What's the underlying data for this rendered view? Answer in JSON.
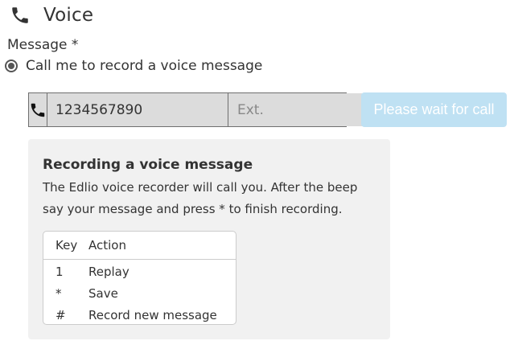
{
  "header": {
    "icon": "phone-icon",
    "title": "Voice"
  },
  "message_field": {
    "label": "Message *",
    "option_label": "Call me to record a voice message",
    "option_selected": true
  },
  "phone_form": {
    "icon": "phone-icon",
    "phone_value": "1234567890",
    "ext_placeholder": "Ext.",
    "ext_value": "",
    "button_label": "Please wait for call",
    "button_color": "#bfe1f3"
  },
  "info": {
    "title": "Recording a voice message",
    "description": "The Edlio voice recorder will call you. After the beep say your message and press * to finish recording.",
    "table": {
      "headers": [
        "Key",
        "Action"
      ],
      "rows": [
        {
          "key": "1",
          "action": "Replay"
        },
        {
          "key": "*",
          "action": "Save"
        },
        {
          "key": "#",
          "action": "Record new message"
        }
      ]
    }
  }
}
